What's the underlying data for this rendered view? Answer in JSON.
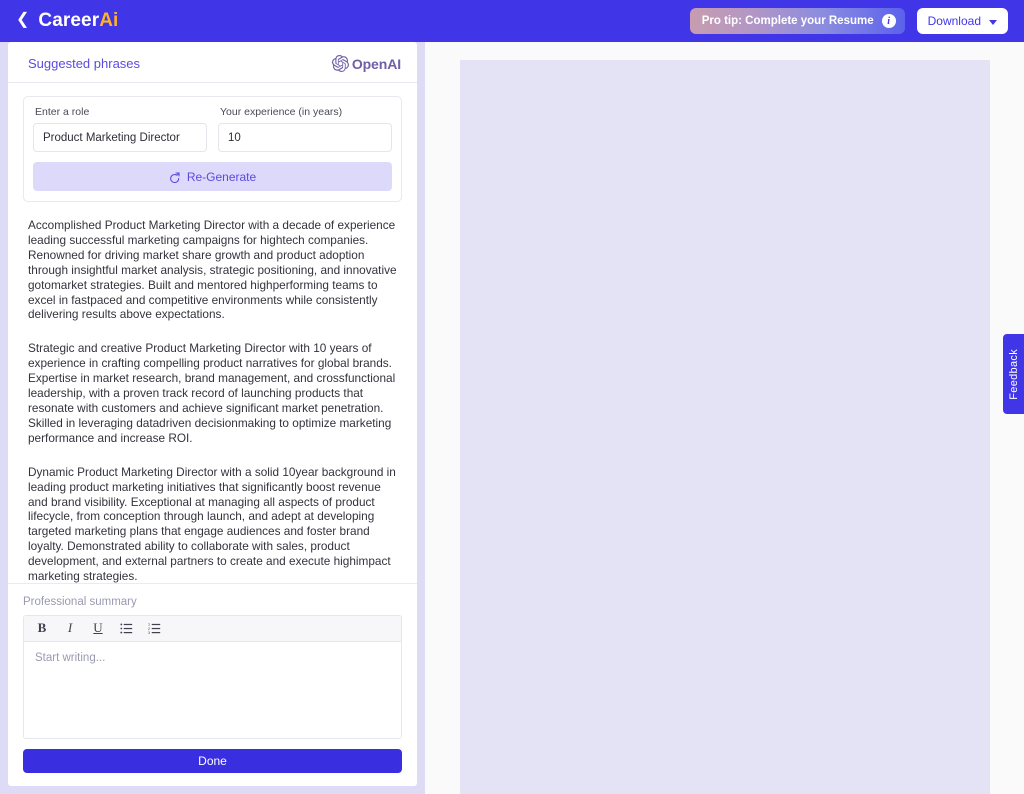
{
  "header": {
    "back_icon": "chevron-left-icon",
    "brand_prefix": "Career",
    "brand_suffix": "Ai",
    "pro_tip_label": "Pro tip: Complete your Resume",
    "pro_tip_info_icon": "info-icon",
    "download_label": "Download",
    "download_chevron_icon": "chevron-down-icon",
    "bar_color": "#4036e8",
    "brand_accent_color": "#ffb224"
  },
  "left_panel": {
    "title": "Suggested phrases",
    "title_color": "#5a4be0",
    "provider": {
      "logo_icon": "openai-logo-icon",
      "name": "OpenAI",
      "color": "#6f5fa6"
    },
    "form": {
      "role_label": "Enter a role",
      "role_value": "Product Marketing Director",
      "role_placeholder": "Enter a role",
      "experience_label": "Your experience (in years)",
      "experience_value": "10",
      "experience_placeholder": "Your experience (in years)",
      "regenerate_label": "Re-Generate",
      "regenerate_icon": "refresh-icon",
      "regenerate_bg": "#ddd9fa",
      "regenerate_color": "#5a4be0"
    },
    "suggestions": [
      "Accomplished Product Marketing Director with a decade of experience leading successful marketing campaigns for hightech companies. Renowned for driving market share growth and product adoption through insightful market analysis, strategic positioning, and innovative gotomarket strategies. Built and mentored highperforming teams to excel in fastpaced and competitive environments while consistently delivering results above expectations.",
      "Strategic and creative Product Marketing Director with 10 years of experience in crafting compelling product narratives for global brands. Expertise in market research, brand management, and crossfunctional leadership, with a proven track record of launching products that resonate with customers and achieve significant market penetration. Skilled in leveraging datadriven decisionmaking to optimize marketing performance and increase ROI.",
      "Dynamic Product Marketing Director with a solid 10year background in leading product marketing initiatives that significantly boost revenue and brand visibility. Exceptional at managing all aspects of product lifecycle, from conception through launch, and adept at developing targeted marketing plans that engage audiences and foster brand loyalty. Demonstrated ability to collaborate with sales, product development, and external partners to create and execute highimpact marketing strategies."
    ],
    "professional_summary": {
      "label": "Professional summary",
      "toolbar": [
        {
          "name": "bold-icon",
          "glyph": "B"
        },
        {
          "name": "italic-icon",
          "glyph": "I"
        },
        {
          "name": "underline-icon",
          "glyph": "U"
        },
        {
          "name": "bullet-list-icon",
          "glyph": "☰"
        },
        {
          "name": "numbered-list-icon",
          "glyph": "☷"
        }
      ],
      "editor_value": "",
      "editor_placeholder": "Start writing..."
    },
    "done_label": "Done",
    "done_bg": "#3a2fe0"
  },
  "collapse_button": {
    "icon": "chevron-double-left-icon",
    "glyph": "«"
  },
  "preview": {
    "document_bg": "#e4e3f6"
  },
  "feedback": {
    "label": "Feedback",
    "bg": "#4036e8"
  }
}
